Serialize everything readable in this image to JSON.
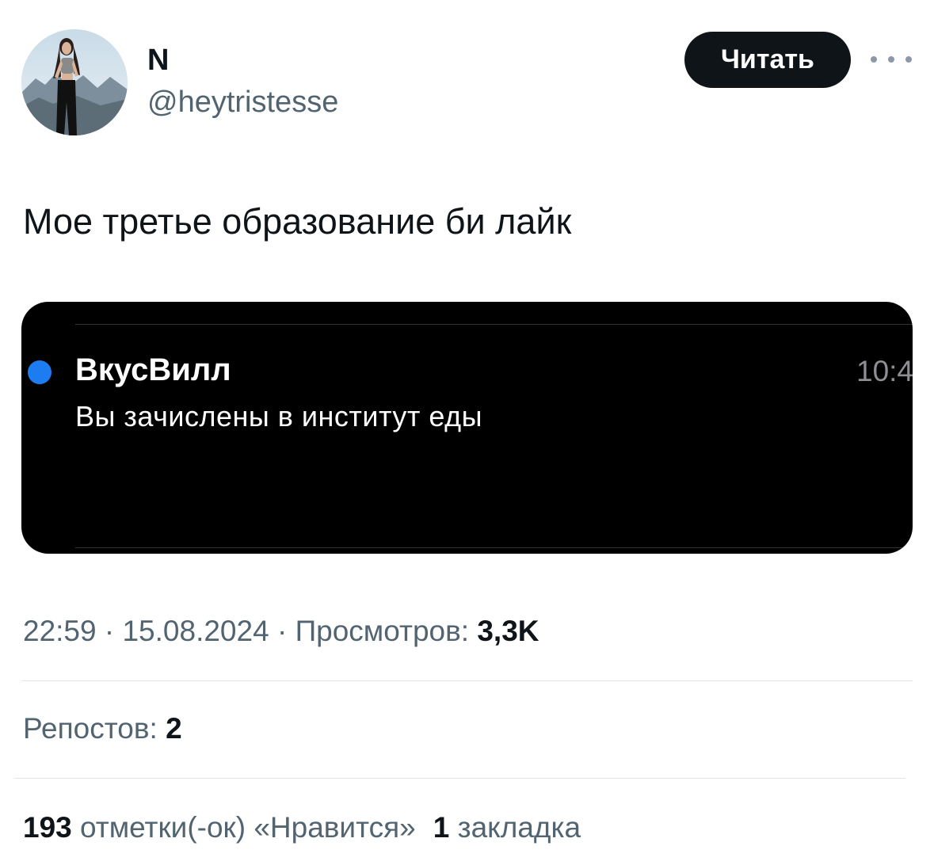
{
  "author": {
    "display_name": "N",
    "handle": "@heytristesse"
  },
  "header": {
    "follow_label": "Читать",
    "more_icon": "more-horizontal-icon"
  },
  "tweet": {
    "text": "Мое третье образование би лайк"
  },
  "media": {
    "notification": {
      "sender": "ВкусВилл",
      "time": "10:4",
      "body": "Вы зачислены в институт еды",
      "dot_color": "#1d7cf2"
    }
  },
  "meta": {
    "time": "22:59",
    "separator": "·",
    "date": "15.08.2024",
    "views_label": "Просмотров:",
    "views_count": "3,3K"
  },
  "reposts": {
    "label": "Репостов:",
    "count": "2"
  },
  "stats": {
    "likes_count": "193",
    "likes_label": "отметки(-ок) «Нравится»",
    "bookmarks_count": "1",
    "bookmarks_label": "закладка"
  }
}
